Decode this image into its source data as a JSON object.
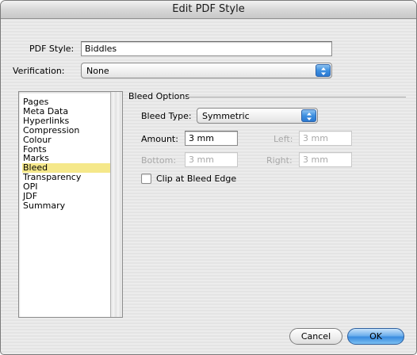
{
  "dialog": {
    "title": "Edit PDF Style"
  },
  "pdf_style": {
    "label": "PDF Style:",
    "value": "Biddles"
  },
  "verification": {
    "label": "Verification:",
    "selected": "None"
  },
  "sidebar": {
    "items": [
      "Pages",
      "Meta Data",
      "Hyperlinks",
      "Compression",
      "Colour",
      "Fonts",
      "Marks",
      "Bleed",
      "Transparency",
      "OPI",
      "JDF",
      "Summary"
    ],
    "selected": "Bleed"
  },
  "bleed": {
    "group_title": "Bleed Options",
    "type_label": "Bleed Type:",
    "type_value": "Symmetric",
    "amount_label": "Amount:",
    "amount_value": "3 mm",
    "left_label": "Left:",
    "left_value": "3 mm",
    "bottom_label": "Bottom:",
    "bottom_value": "3 mm",
    "right_label": "Right:",
    "right_value": "3 mm",
    "clip_label": "Clip at Bleed Edge",
    "clip_checked": false
  },
  "buttons": {
    "cancel": "Cancel",
    "ok": "OK"
  },
  "colors": {
    "selection": "#f5e88a",
    "accent": "#3a8be0"
  }
}
